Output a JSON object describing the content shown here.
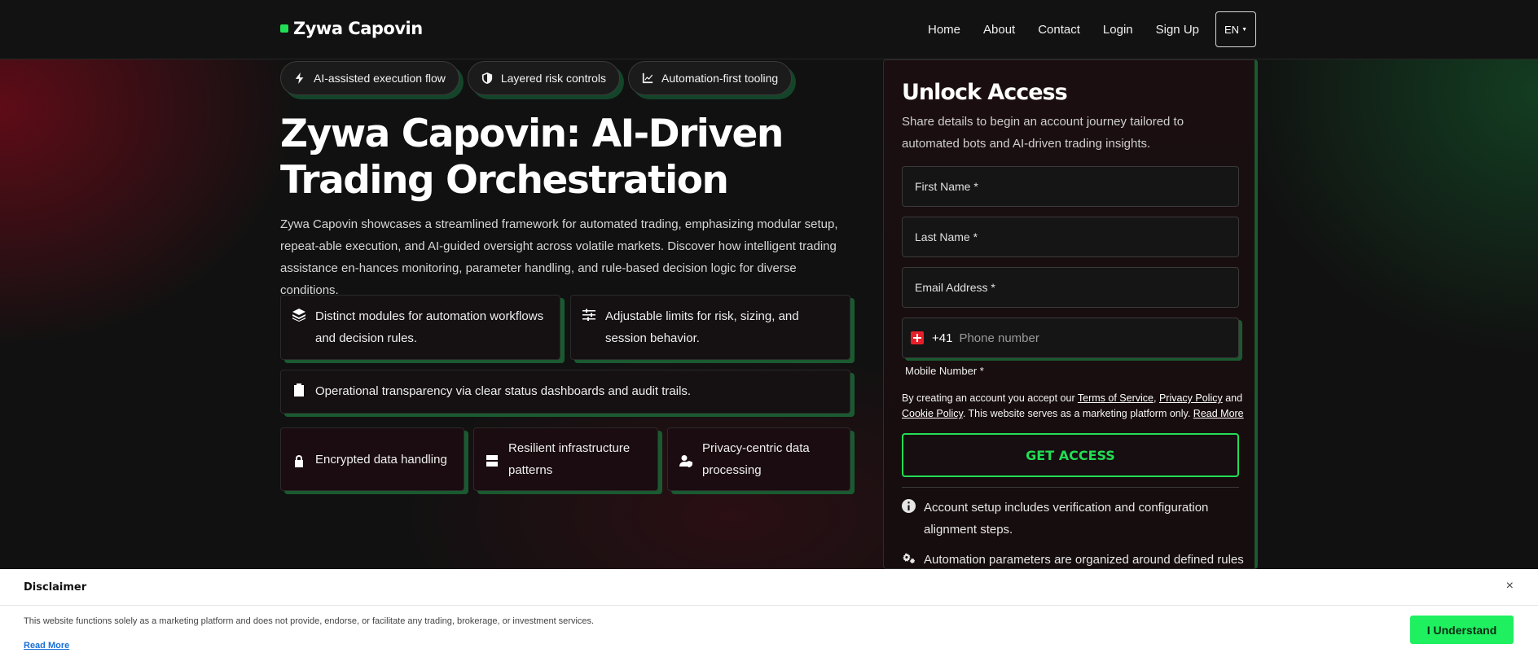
{
  "header": {
    "brand": "Zywa Capovin",
    "nav": [
      "Home",
      "About",
      "Contact",
      "Login",
      "Sign Up"
    ],
    "lang": "EN"
  },
  "pills": [
    {
      "icon": "bolt-icon",
      "label": "AI-assisted execution flow"
    },
    {
      "icon": "shield-icon",
      "label": "Layered risk controls"
    },
    {
      "icon": "chart-line-icon",
      "label": "Automation-first tooling"
    }
  ],
  "hero": {
    "title": "Zywa Capovin: AI-Driven Trading Orchestration",
    "description": "Zywa Capovin showcases a streamlined framework for automated trading, emphasizing modular setup, repeat-able execution, and AI-guided oversight across volatile markets. Discover how intelligent trading assistance en-hances monitoring, parameter handling, and rule-based decision logic for diverse conditions."
  },
  "features": [
    {
      "icon": "layers-icon",
      "label": "Distinct modules for automation workflows and decision rules."
    },
    {
      "icon": "sliders-icon",
      "label": "Adjustable limits for risk, sizing, and session behavior."
    },
    {
      "icon": "clipboard-check-icon",
      "label": "Operational transparency via clear status dashboards and audit trails."
    }
  ],
  "badges": [
    {
      "icon": "lock-icon",
      "label": "Encrypted data handling"
    },
    {
      "icon": "server-icon",
      "label": "Resilient infrastructure patterns"
    },
    {
      "icon": "user-shield-icon",
      "label": "Privacy-centric data processing"
    }
  ],
  "form": {
    "title": "Unlock Access",
    "subtitle": "Share details to begin an account journey tailored to automated bots and AI-driven trading insights.",
    "first_name_placeholder": "First Name *",
    "last_name_placeholder": "Last Name *",
    "email_placeholder": "Email Address *",
    "dial_code": "+41",
    "phone_placeholder": "Phone number",
    "mobile_label": "Mobile Number *",
    "consent_prefix": "By creating an account you accept our ",
    "terms": "Terms of Service",
    "comma": ", ",
    "privacy": "Privacy Policy",
    "and": " and ",
    "cookie": "Cookie Policy",
    "consent_suffix": ". This website serves as a marketing platform only. ",
    "read_more": "Read More",
    "submit": "GET ACCESS",
    "info": [
      {
        "icon": "info-icon",
        "text": "Account setup includes verification and configuration alignment steps."
      },
      {
        "icon": "gears-icon",
        "text": "Automation parameters are organized around defined rules"
      }
    ]
  },
  "disclaimer": {
    "title": "Disclaimer",
    "close": "×",
    "text": "This website functions solely as a marketing platform and does not provide, endorse, or facilitate any trading, brokerage, or investment services.",
    "read_more": "Read More",
    "button": "I Understand"
  }
}
